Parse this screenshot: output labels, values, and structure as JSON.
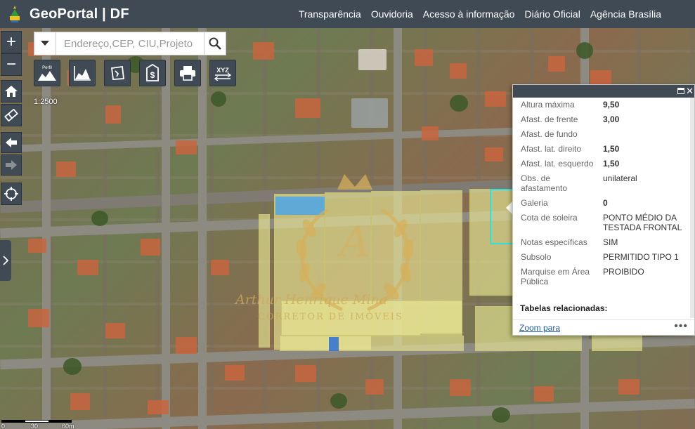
{
  "header": {
    "app_title": "GeoPortal | DF",
    "nav": [
      "Transparência",
      "Ouvidoria",
      "Acesso à informação",
      "Diário Oficial",
      "Agência Brasília"
    ]
  },
  "search": {
    "placeholder": "Endereço,CEP, CIU,Projeto"
  },
  "map": {
    "scale_text": "1:2500",
    "scalebar_labels": [
      "0",
      "30",
      "60m"
    ],
    "watermark": {
      "name": "Arthur Henrique Mina",
      "subtitle": "CORRETOR DE IMÓVEIS"
    }
  },
  "toolbar": {
    "icons": [
      "profile-icon",
      "elevation-icon",
      "measure-icon",
      "price-icon",
      "print-icon",
      "xyz-coordinate-icon"
    ],
    "profile_label": "Perfil",
    "xyz_label": "XYZ"
  },
  "controls": {
    "zoom_in": "+",
    "zoom_out": "−"
  },
  "panel": {
    "attributes": [
      {
        "key": "Altura máxima",
        "value": "9,50"
      },
      {
        "key": "Afast. de frente",
        "value": "3,00"
      },
      {
        "key": "Afast. de fundo",
        "value": ""
      },
      {
        "key": "Afast. lat. direito",
        "value": "1,50"
      },
      {
        "key": "Afast. lat. esquerdo",
        "value": "1,50"
      },
      {
        "key": "Obs. de afastamento",
        "value": "unilateral"
      },
      {
        "key": "Galeria",
        "value": "0"
      },
      {
        "key": "Cota de soleira",
        "value": "PONTO MÉDIO DA TESTADA FRONTAL"
      },
      {
        "key": "Notas específicas",
        "value": "SIM"
      },
      {
        "key": "Subsolo",
        "value": "PERMITIDO TIPO 1"
      },
      {
        "key": "Marquise em Área Pública",
        "value": "PROIBIDO"
      }
    ],
    "related_label": "Tabelas relacionadas:",
    "zoom_link": "Zoom para",
    "more": "•••"
  },
  "colors": {
    "toolbar": "#3f4a54",
    "lot_highlight": "#eeec96",
    "selected_lot": "#2ee0e0",
    "link": "#1f5ea8"
  }
}
